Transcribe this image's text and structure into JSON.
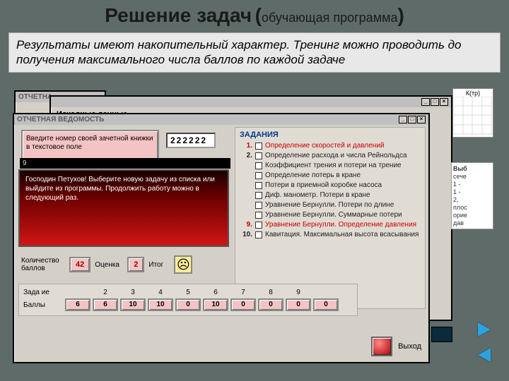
{
  "title": {
    "main": "Решение задач",
    "paren_open": "(",
    "sub": "обучающая программа",
    "paren_close": ")"
  },
  "description": "Результаты имеют накопительный характер. Тренинг можно проводить до получения максимального числа баллов по каждой задаче",
  "bg_win1": {
    "title": "ОТЧЕТНА"
  },
  "bg_win2": {
    "title": "",
    "section": "Исходные данные"
  },
  "chart_label": "К(тр)",
  "side_list": {
    "header": "Выб",
    "items": [
      "сече",
      "1 -",
      "1 -",
      "2,",
      "плос",
      "орие",
      "дав"
    ]
  },
  "main_win": {
    "title": "ОТЧЕТНАЯ ВЕДОМОСТЬ",
    "prompt": "Введите номер своей зачетной книжки в текстовое поле",
    "input_value": "222222",
    "gradient_num": "9",
    "gradient_text": "Господин Петухов! Выберите новую задачу из списка или выйдите из программы. Продолжить работу можно в следующий раз."
  },
  "tasks": {
    "header": "ЗАДАНИЯ",
    "items": [
      {
        "n": "1.",
        "t": "Определение скоростей и давлений",
        "red": true
      },
      {
        "n": "2.",
        "t": "Определение расхода и числа Рейнольдса",
        "red": false
      },
      {
        "n": "",
        "t": "Коэффициент трения и потери на трение",
        "red": false
      },
      {
        "n": "",
        "t": "Определение потерь в кране",
        "red": false
      },
      {
        "n": "",
        "t": "Потери в приемной коробке насоса",
        "red": false
      },
      {
        "n": "",
        "t": "Диф. манометр. Потери в кране",
        "red": false
      },
      {
        "n": "",
        "t": "Уравнение Бернулли. Потери по длине",
        "red": false
      },
      {
        "n": "",
        "t": "Уравнение Бернулли. Суммарные потери",
        "red": false
      },
      {
        "n": "9.",
        "t": "Уравнение Бернулли. Определение давления",
        "red": true
      },
      {
        "n": "10.",
        "t": "Кавитация. Максимальная высота всасывания",
        "red": false
      }
    ]
  },
  "scores": {
    "count_label": "Количество баллов",
    "count_value": "42",
    "grade_label": "Оценка",
    "grade_value": "2",
    "result_label": "Итог",
    "face": "☹"
  },
  "table": {
    "row1_label": "Зада ие",
    "row2_label": "Баллы",
    "cols": [
      "",
      "2",
      "3",
      "4",
      "5",
      "6",
      "7",
      "8",
      "9",
      ""
    ],
    "vals": [
      "",
      "6",
      "6",
      "10",
      "10",
      "0",
      "10",
      "0",
      "0",
      "0",
      "0"
    ]
  },
  "exit": {
    "label": "Выход"
  },
  "icons": {
    "minimize": "_",
    "maximize": "□",
    "close": "×"
  }
}
